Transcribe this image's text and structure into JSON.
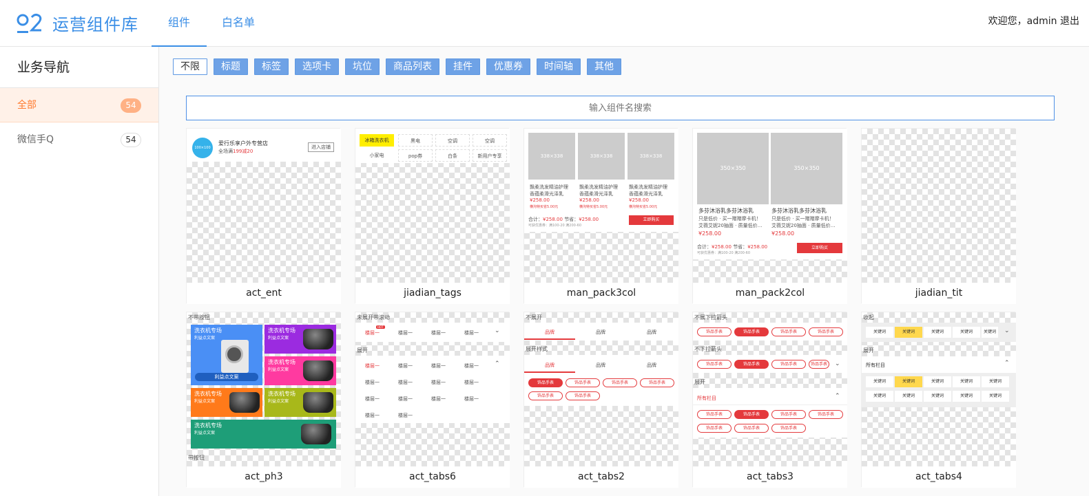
{
  "app": {
    "title": "运营组件库",
    "nav_tabs": [
      {
        "label": "组件",
        "active": true
      },
      {
        "label": "白名单",
        "active": false
      }
    ],
    "user": {
      "greeting": "欢迎您，admin",
      "logout": "退出"
    }
  },
  "sidebar": {
    "title": "业务导航",
    "items": [
      {
        "label": "全部",
        "count": "54",
        "active": true
      },
      {
        "label": "微信手Q",
        "count": "54",
        "active": false
      }
    ]
  },
  "filters": [
    "不限",
    "标题",
    "标签",
    "选项卡",
    "坑位",
    "商品列表",
    "挂件",
    "优惠券",
    "时间轴",
    "其他"
  ],
  "search": {
    "placeholder": "输入组件名搜索"
  },
  "cards": [
    {
      "name": "act_ent"
    },
    {
      "name": "jiadian_tags"
    },
    {
      "name": "man_pack3col"
    },
    {
      "name": "man_pack2col"
    },
    {
      "name": "jiadian_tit"
    },
    {
      "name": "act_ph3"
    },
    {
      "name": "act_tabs6"
    },
    {
      "name": "act_tabs2"
    },
    {
      "name": "act_tabs3"
    },
    {
      "name": "act_tabs4"
    }
  ],
  "previews": {
    "act_ent": {
      "shop": "爱行乐享户外专营店",
      "desc_prefix": "全场满",
      "desc_red": "199减20",
      "button": "进入店铺",
      "avatar": "100×100"
    },
    "jiadian_tags": {
      "tags": [
        "冰箱洗衣机",
        "黑电",
        "空调",
        "空调",
        "小家电",
        "pop券",
        "白条",
        "新用户专享"
      ]
    },
    "man_pack3col": {
      "img": "338×338",
      "title1": "飘柔洗发精油护理",
      "title2": "香蕴柔滑光泽乳",
      "price": "¥258.00",
      "tag": "横沟特买省5.00元",
      "total": "合计：",
      "total_price": "¥258.00",
      "save": "节省：",
      "save_price": "¥258.00",
      "promo": "可获优惠券：满100-20  满200-60",
      "buy": "立即购买"
    },
    "man_pack2col": {
      "img": "350×350",
      "title": "多芬沐浴乳多芬沐浴乳",
      "desc1": "只是低价 · 买一赠赠摩卡机！",
      "desc2": "艾薇艾妮20抽面 · 质量低价…",
      "price": "¥258.00",
      "total": "合计：",
      "total_price": "¥258.00",
      "save": "节省：",
      "save_price": "¥258.00",
      "promo": "可获优惠券：满100-20  满200-60",
      "buy": "立即购买"
    },
    "act_ph3": {
      "top": "不带按钮",
      "bottom": "带按钮",
      "tile_title": "洗衣机专场",
      "tile_sub": "利益点文案",
      "cta": "利益点文案"
    },
    "act_tabs6": {
      "label1": "未展开带滚动",
      "label2": "展开",
      "tab": "楼层一",
      "hot": "HOT"
    },
    "act_tabs2": {
      "label1": "不展开",
      "label2": "展开样式",
      "tab": "品牌",
      "pill": "饰品手表"
    },
    "act_tabs3": {
      "label1": "不展下拉箭头",
      "label2": "不下拉箭头",
      "label3": "展开",
      "all": "所有栏目",
      "pill": "饰品手表"
    },
    "act_tabs4": {
      "label1": "收起",
      "label2": "展开",
      "all": "所有栏目",
      "kw": "关键词"
    }
  },
  "colors": {
    "accent": "#3a8ee6",
    "sidebar_active": "#ff7a2e",
    "filter_bg": "#6ea2e6",
    "promo_red": "#e4393c"
  }
}
